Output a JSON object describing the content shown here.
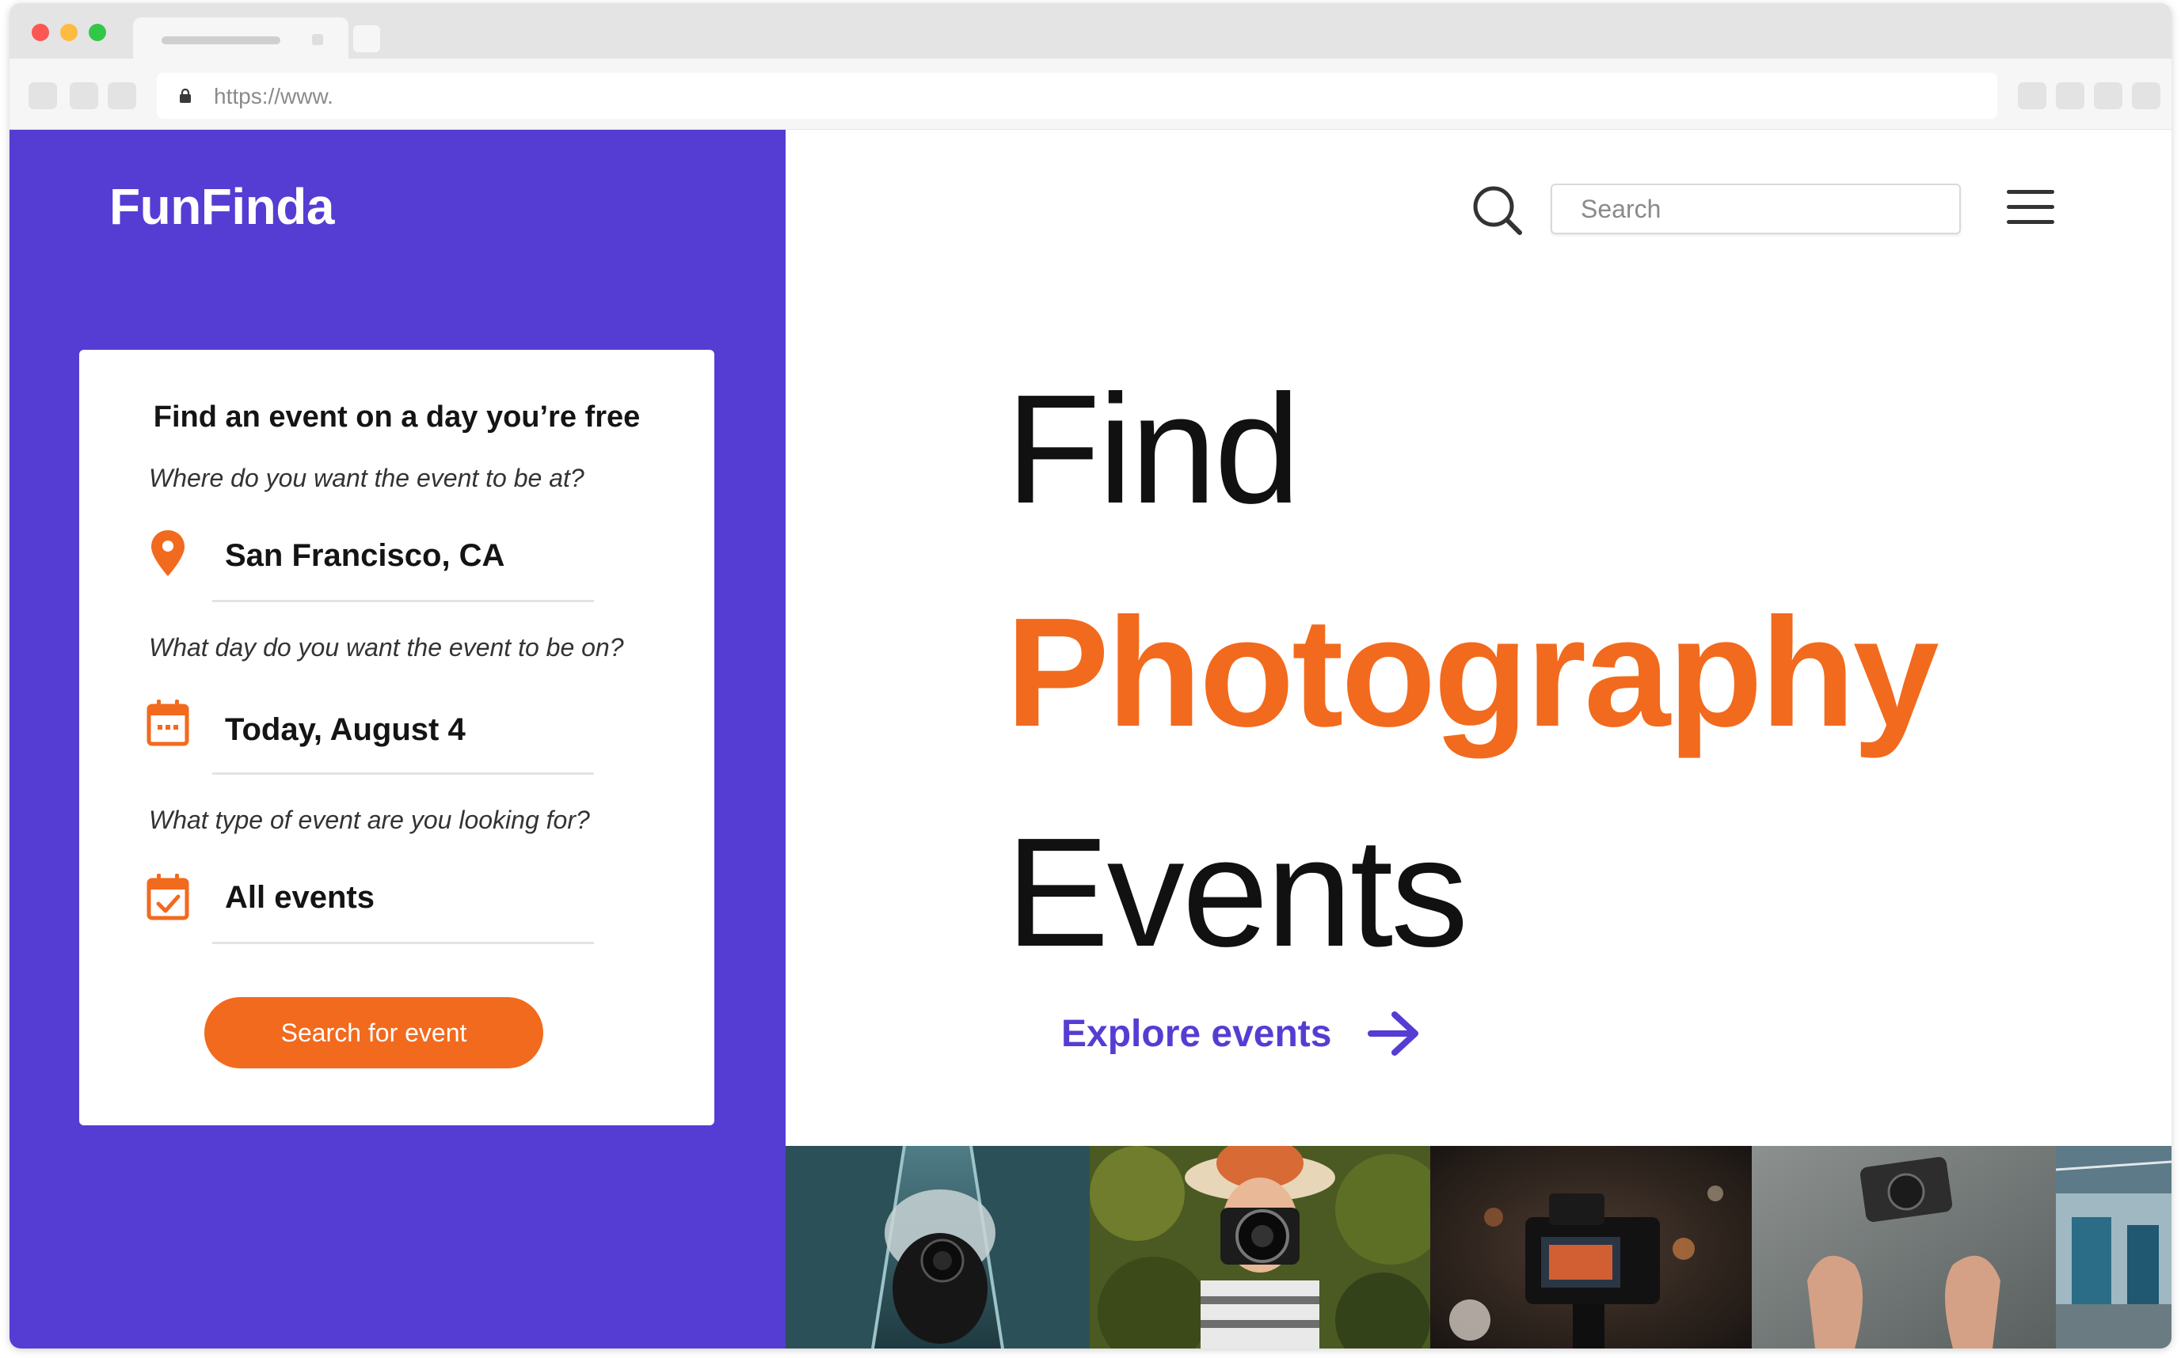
{
  "browser": {
    "url": "https://www."
  },
  "brand": {
    "name": "FunFinda"
  },
  "search": {
    "placeholder": "Search"
  },
  "form": {
    "title": "Find an event on a day you’re free",
    "location": {
      "label": "Where do you want the event to be at?",
      "value": "San Francisco, CA",
      "icon": "location-pin-icon"
    },
    "date": {
      "label": "What day do you want the event to be on?",
      "value": "Today, August 4",
      "icon": "calendar-icon"
    },
    "type": {
      "label": "What type of event are you looking for?",
      "value": "All events",
      "icon": "calendar-check-icon"
    },
    "submit_label": "Search for event"
  },
  "hero": {
    "line1": "Find",
    "line2": "Photography",
    "line3": "Events"
  },
  "explore": {
    "label": "Explore events",
    "icon": "arrow-right-icon"
  },
  "photos": [
    {
      "subject": "photographer with camera on escalator"
    },
    {
      "subject": "woman in hat holding camera among plants"
    },
    {
      "subject": "camera on tripod with bokeh lights"
    },
    {
      "subject": "hands tossing a camera"
    },
    {
      "subject": "station interior"
    }
  ],
  "colors": {
    "brand_purple": "#553dd3",
    "accent_orange": "#f26a1d",
    "text_dark": "#111111"
  }
}
